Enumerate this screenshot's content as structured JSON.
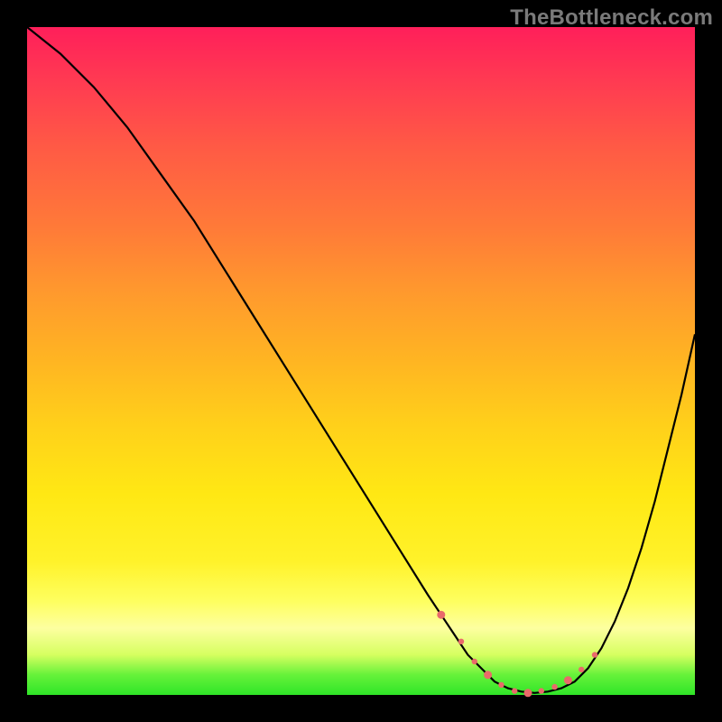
{
  "watermark": "TheBottleneck.com",
  "colors": {
    "page_bg": "#000000",
    "gradient_stops": [
      "#ff1f5a",
      "#ff3a52",
      "#ff5a45",
      "#ff7a38",
      "#ff9a2d",
      "#ffb522",
      "#ffd11a",
      "#ffe814",
      "#fff22a",
      "#feff60",
      "#fdffa0",
      "#d6ff60",
      "#66f23a",
      "#2fe528"
    ],
    "curve_stroke": "#000000",
    "marker_fill": "#e96a6a"
  },
  "chart_data": {
    "type": "line",
    "title": "",
    "xlabel": "",
    "ylabel": "",
    "xlim": [
      0,
      100
    ],
    "ylim": [
      0,
      100
    ],
    "grid": false,
    "legend": false,
    "series": [
      {
        "name": "bottleneck-curve",
        "x": [
          0,
          5,
          10,
          15,
          20,
          25,
          30,
          35,
          40,
          45,
          50,
          55,
          60,
          62,
          64,
          66,
          68,
          70,
          72,
          74,
          76,
          78,
          80,
          82,
          84,
          86,
          88,
          90,
          92,
          94,
          96,
          98,
          100
        ],
        "values": [
          100,
          96,
          91,
          85,
          78,
          71,
          63,
          55,
          47,
          39,
          31,
          23,
          15,
          12,
          9,
          6,
          4,
          2,
          1,
          0.5,
          0.3,
          0.5,
          1,
          2,
          4,
          7,
          11,
          16,
          22,
          29,
          37,
          45,
          54
        ]
      }
    ],
    "markers": {
      "name": "highlight-band",
      "x": [
        62,
        65,
        67,
        69,
        71,
        73,
        75,
        77,
        79,
        81,
        83,
        85
      ],
      "values": [
        12,
        8,
        5,
        3,
        1.5,
        0.6,
        0.3,
        0.6,
        1.2,
        2.2,
        3.8,
        6
      ]
    }
  }
}
